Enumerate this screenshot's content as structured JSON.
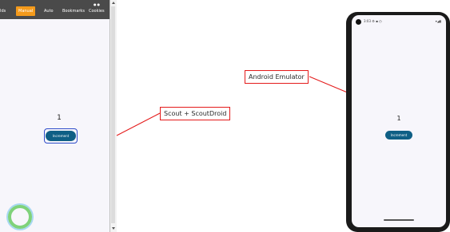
{
  "scout": {
    "tabs": [
      {
        "label": "Ids"
      },
      {
        "label": "Manual"
      },
      {
        "label": "Auto"
      },
      {
        "label": "Bookmarks"
      },
      {
        "label": "Cookies"
      }
    ],
    "active_tab": "Manual",
    "counter_value": "1",
    "increment_label": "Increment"
  },
  "labels": {
    "scout": "Scout + ScoutDroid",
    "emulator": "Android Emulator"
  },
  "emulator": {
    "status_time": "3:03",
    "counter_value": "1",
    "increment_label": "Increment"
  },
  "colors": {
    "accent_tab": "#f49a1b",
    "button": "#0f5f85",
    "label_border": "#e41a1a",
    "focus_outline": "#2e4cc9"
  }
}
